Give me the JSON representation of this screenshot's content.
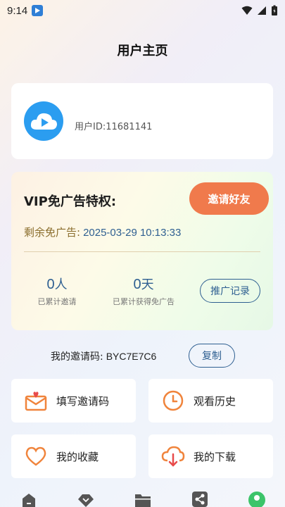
{
  "status_bar": {
    "time": "9:14"
  },
  "header": {
    "title": "用户主页"
  },
  "profile": {
    "user_id": "用户ID:11681141"
  },
  "vip": {
    "title": "VIP免广告特权:",
    "invite_button": "邀请好友",
    "remaining_label": "剩余免广告:",
    "remaining_value": "2025-03-29 10:13:33",
    "stats": {
      "invited_count": "0",
      "invited_unit": "人",
      "invited_label": "已累计邀请",
      "days_count": "0",
      "days_unit": "天",
      "days_label": "已累计获得免广告"
    },
    "promo_button": "推广记录"
  },
  "invite_code": {
    "label": "我的邀请码:",
    "value": "BYC7E7C6",
    "copy_button": "复制"
  },
  "menu": [
    {
      "label": "填写邀请码",
      "icon": "envelope-heart-icon"
    },
    {
      "label": "观看历史",
      "icon": "clock-icon"
    },
    {
      "label": "我的收藏",
      "icon": "heart-icon"
    },
    {
      "label": "我的下载",
      "icon": "cloud-download-icon"
    }
  ],
  "tab_bar": {
    "tabs": [
      "home-icon",
      "diamond-icon",
      "folder-icon",
      "share-icon",
      "profile-icon"
    ]
  },
  "colors": {
    "accent_orange": "#f07a4c",
    "accent_blue": "#2e5f91",
    "avatar_blue": "#2b9df0"
  }
}
